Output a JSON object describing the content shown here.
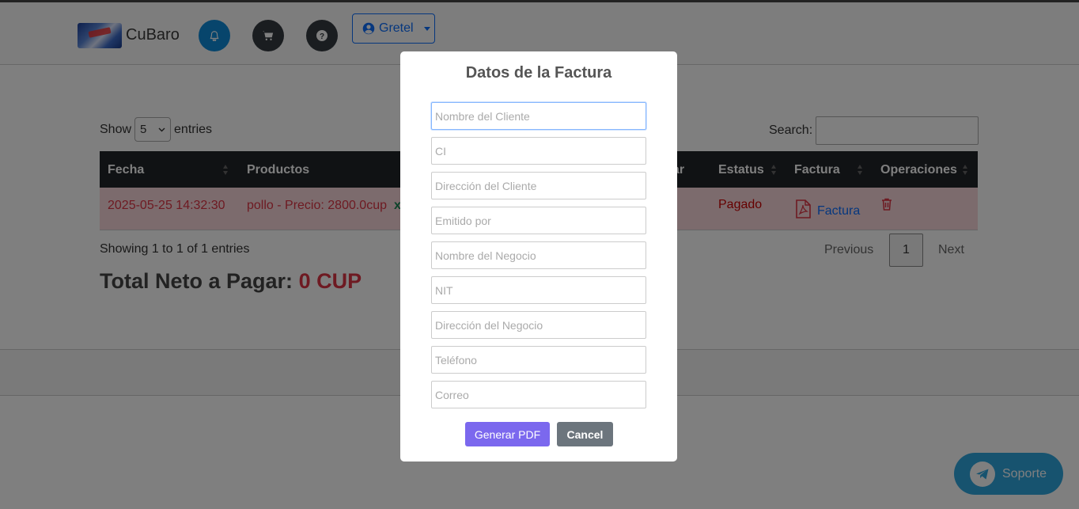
{
  "header": {
    "brand": "CuBaro",
    "user_label": "Gretel",
    "icons": [
      "bell-icon",
      "cart-icon",
      "help-icon",
      "user-circle-icon"
    ]
  },
  "table_controls": {
    "show_label": "Show",
    "entries_value": "5",
    "entries_label": "entries",
    "search_label": "Search:"
  },
  "table": {
    "columns": [
      "Fecha",
      "Productos",
      "ar",
      "Estatus",
      "Factura",
      "Operaciones"
    ],
    "rows": [
      {
        "fecha": "2025-05-25 14:32:30",
        "productos": "pollo - Precio: 2800.0cup",
        "extra": "x",
        "estatus": "Pagado",
        "factura": "Factura"
      }
    ]
  },
  "pagination": {
    "info": "Showing 1 to 1 of 1 entries",
    "previous": "Previous",
    "page": "1",
    "next": "Next"
  },
  "total": {
    "label": "Total Neto a Pagar:",
    "value": "0 CUP"
  },
  "modal": {
    "title": "Datos de la Factura",
    "fields": [
      {
        "placeholder": "Nombre del Cliente"
      },
      {
        "placeholder": "CI"
      },
      {
        "placeholder": "Dirección del Cliente"
      },
      {
        "placeholder": "Emitido por"
      },
      {
        "placeholder": "Nombre del Negocio"
      },
      {
        "placeholder": "NIT"
      },
      {
        "placeholder": "Dirección del Negocio"
      },
      {
        "placeholder": "Teléfono"
      },
      {
        "placeholder": "Correo"
      }
    ],
    "generate_label": "Generar PDF",
    "cancel_label": "Cancel"
  },
  "support": {
    "label": "Soporte"
  },
  "colors": {
    "accent": "#0d6efd",
    "danger": "#dc3545",
    "row_bg": "#f8d7da",
    "generate_btn": "#7b68ee",
    "support_btn": "#2ea6df"
  }
}
